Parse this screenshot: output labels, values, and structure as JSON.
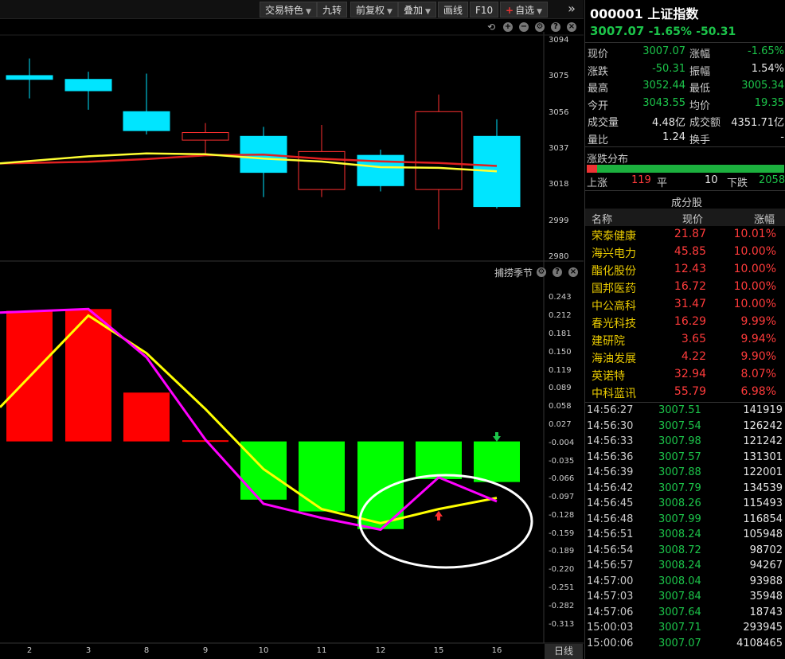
{
  "toolbar": {
    "items": [
      {
        "label": "交易特色",
        "caret": true
      },
      {
        "label": "九转",
        "caret": false
      },
      {
        "label": "前复权",
        "caret": true
      },
      {
        "label": "叠加",
        "caret": true
      },
      {
        "label": "画线",
        "caret": false
      },
      {
        "label": "F10",
        "caret": false
      },
      {
        "label": "自选",
        "caret": true
      }
    ],
    "more": "»"
  },
  "chart_data": [
    {
      "type": "candlestick",
      "right_ticks": [
        "3094",
        "3075",
        "3056",
        "3037",
        "3018",
        "2999",
        "2980"
      ],
      "ylim": [
        2980,
        3094
      ],
      "x": [
        "2",
        "3",
        "8",
        "9",
        "10",
        "11",
        "12",
        "15",
        "16"
      ],
      "candles": [
        {
          "open": 3076,
          "close": 3074,
          "high": 3085,
          "low": 3064,
          "color": "cyan"
        },
        {
          "open": 3074,
          "close": 3068,
          "high": 3078,
          "low": 3058,
          "color": "cyan"
        },
        {
          "open": 3057,
          "close": 3047,
          "high": 3077,
          "low": 3045,
          "color": "cyan"
        },
        {
          "open": 3042,
          "close": 3046,
          "high": 3051,
          "low": 3035,
          "color": "red"
        },
        {
          "open": 3044,
          "close": 3025,
          "high": 3049,
          "low": 3012,
          "color": "cyan"
        },
        {
          "open": 3016,
          "close": 3036,
          "high": 3050,
          "low": 3012,
          "color": "red"
        },
        {
          "open": 3034,
          "close": 3018,
          "high": 3037,
          "low": 3015,
          "color": "cyan"
        },
        {
          "open": 3016,
          "close": 3057,
          "high": 3066,
          "low": 2995,
          "color": "red"
        },
        {
          "open": 3044,
          "close": 3007,
          "high": 3053,
          "low": 3006,
          "color": "cyan"
        }
      ],
      "ma_yellow": [
        3031,
        3033.5,
        3035,
        3034.6,
        3032.3,
        3030.7,
        3027.8,
        3027.4,
        3025.6
      ],
      "ma_red": [
        3030,
        3030.6,
        3032,
        3034,
        3034.4,
        3032.2,
        3030.8,
        3030,
        3028.4
      ]
    },
    {
      "type": "bar+line",
      "name": "捕捞季节",
      "right_ticks": [
        "0.243",
        "0.212",
        "0.181",
        "0.150",
        "0.119",
        "0.089",
        "0.058",
        "0.027",
        "-0.004",
        "-0.035",
        "-0.066",
        "-0.097",
        "-0.128",
        "-0.159",
        "-0.189",
        "-0.220",
        "-0.251",
        "-0.282",
        "-0.313"
      ],
      "ylim": [
        -0.313,
        0.243
      ],
      "x": [
        "2",
        "3",
        "8",
        "9",
        "10",
        "11",
        "12",
        "15",
        "16"
      ],
      "bars": [
        0.222,
        0.225,
        0.083,
        0.002,
        -0.099,
        -0.119,
        -0.149,
        -0.064,
        -0.069
      ],
      "magenta_line": [
        0.221,
        0.225,
        0.143,
        0.003,
        -0.106,
        -0.13,
        -0.15,
        -0.061,
        -0.102
      ],
      "yellow_line": [
        0.11,
        0.214,
        0.15,
        0.055,
        -0.047,
        -0.115,
        -0.139,
        -0.115,
        -0.096
      ],
      "signal_up_at": "15",
      "signal_down_at": "16"
    }
  ],
  "period_button": "日线",
  "panel": {
    "code_name": "000001 上证指数",
    "price": "3007.07",
    "change_pct": "-1.65%",
    "change": "-50.31",
    "stats": [
      {
        "l1": "现价",
        "v1": "3007.07",
        "c1": "green",
        "l2": "涨幅",
        "v2": "-1.65%",
        "c2": "green"
      },
      {
        "l1": "涨跌",
        "v1": "-50.31",
        "c1": "green",
        "l2": "振幅",
        "v2": "1.54%",
        "c2": "white"
      },
      {
        "l1": "最高",
        "v1": "3052.44",
        "c1": "green",
        "l2": "最低",
        "v2": "3005.34",
        "c2": "green"
      },
      {
        "l1": "今开",
        "v1": "3043.55",
        "c1": "green",
        "l2": "均价",
        "v2": "19.35",
        "c2": "green"
      },
      {
        "l1": "成交量",
        "v1": "4.48亿",
        "c1": "white",
        "l2": "成交额",
        "v2": "4351.71亿",
        "c2": "white"
      },
      {
        "l1": "量比",
        "v1": "1.24",
        "c1": "white",
        "l2": "换手",
        "v2": "-",
        "c2": "white"
      }
    ],
    "dist_title": "涨跌分布",
    "dist": {
      "up_label": "上涨",
      "up": "119",
      "flat_label": "平",
      "flat": "10",
      "down_label": "下跌",
      "down": "2058",
      "up_fraction": 0.054
    },
    "constituents_title": "成分股",
    "headers": [
      "名称",
      "现价",
      "涨幅"
    ],
    "stocks": [
      {
        "name": "荣泰健康",
        "price": "21.87",
        "chg": "10.01%"
      },
      {
        "name": "海兴电力",
        "price": "45.85",
        "chg": "10.00%"
      },
      {
        "name": "酯化股份",
        "price": "12.43",
        "chg": "10.00%"
      },
      {
        "name": "国邦医药",
        "price": "16.72",
        "chg": "10.00%"
      },
      {
        "name": "中公高科",
        "price": "31.47",
        "chg": "10.00%"
      },
      {
        "name": "春光科技",
        "price": "16.29",
        "chg": "9.99%"
      },
      {
        "name": "建研院",
        "price": "3.65",
        "chg": "9.94%"
      },
      {
        "name": "海油发展",
        "price": "4.22",
        "chg": "9.90%"
      },
      {
        "name": "英诺特",
        "price": "32.94",
        "chg": "8.07%"
      },
      {
        "name": "中科蓝讯",
        "price": "55.79",
        "chg": "6.98%"
      }
    ],
    "ticks": [
      {
        "t": "14:56:27",
        "p": "3007.51",
        "v": "141919"
      },
      {
        "t": "14:56:30",
        "p": "3007.54",
        "v": "126242"
      },
      {
        "t": "14:56:33",
        "p": "3007.98",
        "v": "121242"
      },
      {
        "t": "14:56:36",
        "p": "3007.57",
        "v": "131301"
      },
      {
        "t": "14:56:39",
        "p": "3007.88",
        "v": "122001"
      },
      {
        "t": "14:56:42",
        "p": "3007.79",
        "v": "134539"
      },
      {
        "t": "14:56:45",
        "p": "3008.26",
        "v": "115493"
      },
      {
        "t": "14:56:48",
        "p": "3007.99",
        "v": "116854"
      },
      {
        "t": "14:56:51",
        "p": "3008.24",
        "v": "105948"
      },
      {
        "t": "14:56:54",
        "p": "3008.72",
        "v": "98702"
      },
      {
        "t": "14:56:57",
        "p": "3008.24",
        "v": "94267"
      },
      {
        "t": "14:57:00",
        "p": "3008.04",
        "v": "93988"
      },
      {
        "t": "14:57:03",
        "p": "3007.84",
        "v": "35948"
      },
      {
        "t": "14:57:06",
        "p": "3007.64",
        "v": "18743"
      },
      {
        "t": "15:00:03",
        "p": "3007.71",
        "v": "293945"
      },
      {
        "t": "15:00:06",
        "p": "3007.07",
        "v": "4108465"
      }
    ]
  }
}
